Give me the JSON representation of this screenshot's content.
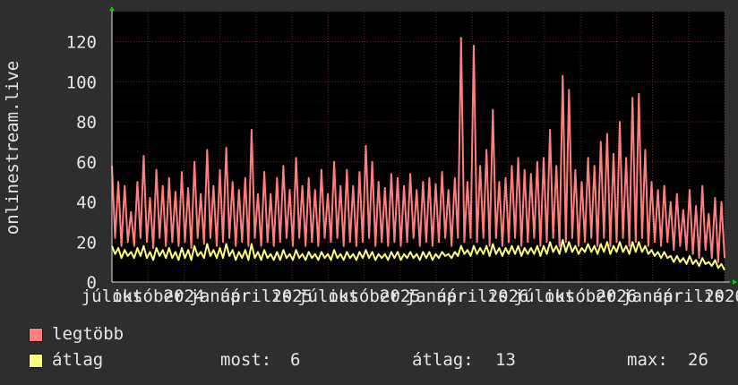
{
  "ylabel": "onlinestream.live",
  "legend": {
    "max_label": "legtöbb",
    "avg_label": "átlag",
    "now_label": "most:",
    "now_value": "6",
    "avg_stat_label": "átlag:",
    "avg_stat_value": "13",
    "max_stat_label": "max:",
    "max_stat_value": "26"
  },
  "colors": {
    "background": "#2e2e2e",
    "plot_background": "#000000",
    "grid": "#5a2a2a",
    "max_series": "#ff7f7f",
    "avg_series": "#ffff7f",
    "axis_arrow": "#00cc00"
  },
  "chart_data": {
    "type": "line",
    "ylim": [
      0,
      135
    ],
    "y_ticks": [
      0,
      20,
      40,
      60,
      80,
      100,
      120
    ],
    "x_tick_labels": [
      "július",
      "október",
      "2024",
      "január",
      "április",
      "2025",
      "július",
      "október",
      "2025",
      "január",
      "április",
      "2026",
      "július",
      "október",
      "2026",
      "január",
      "április",
      "2026"
    ],
    "series": [
      {
        "name": "legtöbb",
        "values": [
          58,
          22,
          50,
          18,
          48,
          20,
          35,
          18,
          50,
          22,
          63,
          20,
          42,
          17,
          56,
          22,
          48,
          18,
          52,
          20,
          45,
          18,
          55,
          20,
          47,
          17,
          60,
          22,
          44,
          19,
          66,
          22,
          48,
          18,
          56,
          20,
          67,
          22,
          50,
          18,
          46,
          20,
          52,
          18,
          76,
          22,
          44,
          18,
          55,
          20,
          44,
          18,
          52,
          20,
          58,
          22,
          46,
          18,
          62,
          22,
          48,
          18,
          52,
          20,
          46,
          18,
          56,
          22,
          44,
          20,
          60,
          22,
          48,
          18,
          56,
          20,
          48,
          18,
          55,
          20,
          68,
          22,
          60,
          18,
          50,
          20,
          47,
          18,
          54,
          20,
          52,
          18,
          48,
          20,
          54,
          22,
          46,
          18,
          50,
          20,
          52,
          18,
          49,
          20,
          55,
          22,
          46,
          18,
          52,
          22,
          122,
          20,
          50,
          22,
          118,
          20,
          58,
          22,
          66,
          18,
          86,
          22,
          50,
          18,
          52,
          20,
          58,
          22,
          62,
          18,
          56,
          20,
          54,
          22,
          60,
          18,
          62,
          20,
          76,
          22,
          58,
          18,
          103,
          20,
          96,
          22,
          56,
          18,
          50,
          20,
          62,
          22,
          58,
          18,
          70,
          22,
          74,
          18,
          64,
          20,
          80,
          22,
          62,
          18,
          92,
          20,
          94,
          22,
          66,
          18,
          50,
          20,
          46,
          18,
          48,
          20,
          40,
          16,
          44,
          18,
          36,
          16,
          46,
          14,
          38,
          12,
          48,
          16,
          34,
          12,
          42,
          10,
          40,
          12
        ],
        "color": "#ff7f7f"
      },
      {
        "name": "átlag",
        "values": [
          18,
          14,
          17,
          12,
          16,
          13,
          15,
          12,
          17,
          13,
          18,
          12,
          15,
          11,
          17,
          13,
          16,
          12,
          17,
          12,
          15,
          11,
          17,
          12,
          16,
          11,
          18,
          13,
          15,
          12,
          19,
          13,
          16,
          12,
          17,
          12,
          19,
          13,
          16,
          11,
          15,
          12,
          16,
          11,
          19,
          12,
          15,
          11,
          16,
          12,
          14,
          11,
          15,
          11,
          16,
          12,
          14,
          11,
          16,
          12,
          14,
          11,
          15,
          12,
          14,
          11,
          15,
          12,
          14,
          11,
          16,
          12,
          14,
          11,
          15,
          12,
          14,
          11,
          15,
          12,
          16,
          12,
          15,
          11,
          14,
          12,
          14,
          11,
          15,
          12,
          15,
          11,
          14,
          12,
          15,
          12,
          14,
          11,
          15,
          12,
          15,
          11,
          14,
          12,
          15,
          13,
          14,
          12,
          15,
          13,
          18,
          14,
          16,
          13,
          18,
          14,
          17,
          14,
          18,
          13,
          19,
          14,
          17,
          13,
          17,
          14,
          18,
          14,
          18,
          13,
          17,
          14,
          17,
          14,
          18,
          13,
          18,
          14,
          20,
          15,
          18,
          14,
          21,
          15,
          20,
          15,
          18,
          14,
          17,
          15,
          19,
          15,
          18,
          14,
          19,
          15,
          20,
          14,
          18,
          15,
          20,
          15,
          18,
          14,
          20,
          15,
          20,
          15,
          18,
          14,
          16,
          13,
          15,
          12,
          15,
          12,
          13,
          10,
          13,
          10,
          12,
          9,
          13,
          9,
          11,
          8,
          12,
          9,
          10,
          8,
          11,
          7,
          9,
          6
        ],
        "color": "#ffff7f"
      }
    ]
  }
}
